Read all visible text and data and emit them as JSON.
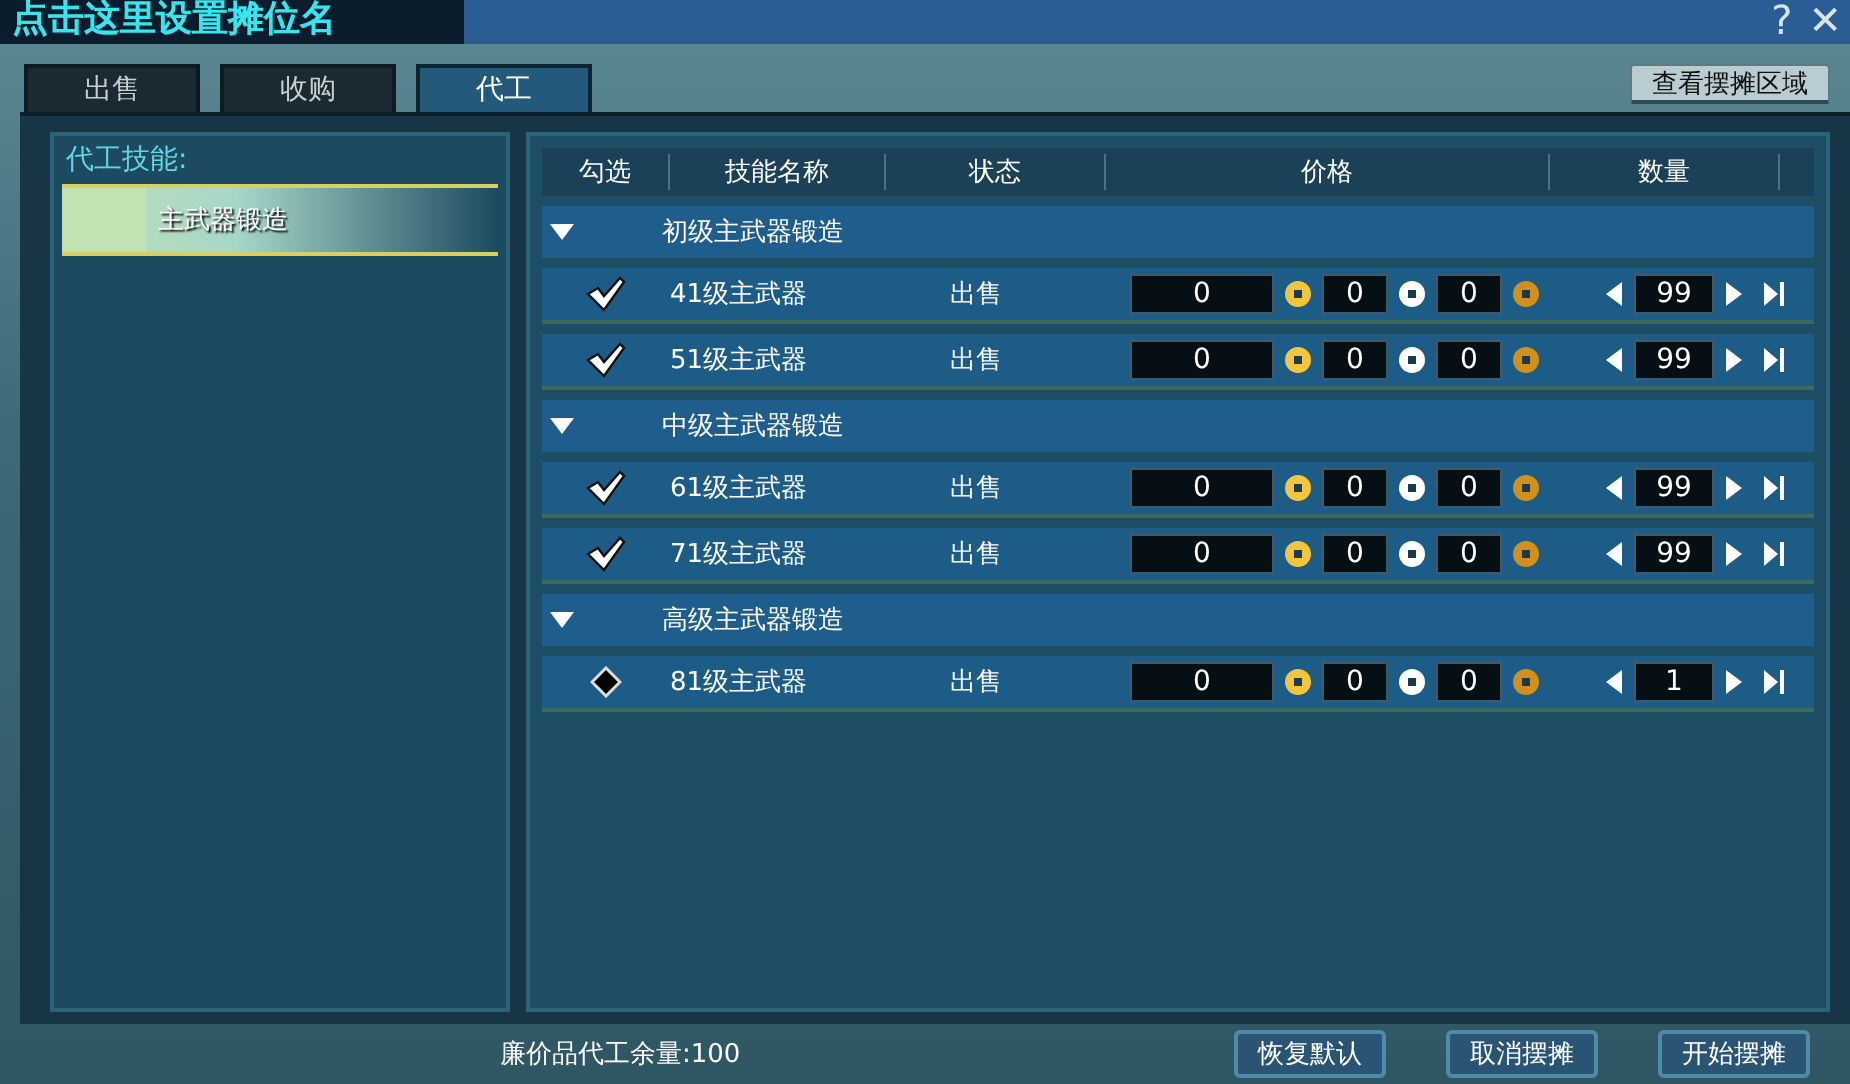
{
  "window": {
    "title": "点击这里设置摊位名",
    "help": "?",
    "close": "✕"
  },
  "tabs": [
    {
      "label": "出售",
      "selected": false
    },
    {
      "label": "收购",
      "selected": false
    },
    {
      "label": "代工",
      "selected": true
    }
  ],
  "view_area_button": "查看摆摊区域",
  "skills_panel": {
    "title": "代工技能:",
    "items": [
      {
        "label": "主武器锻造",
        "selected": true
      }
    ]
  },
  "table": {
    "columns": [
      "勾选",
      "技能名称",
      "状态",
      "价格",
      "数量"
    ],
    "groups": [
      {
        "name": "初级主武器锻造",
        "expanded": true,
        "rows": [
          {
            "checked": true,
            "name": "41级主武器",
            "status": "出售",
            "gold": "0",
            "silver": "0",
            "copper": "0",
            "quantity": "99"
          },
          {
            "checked": true,
            "name": "51级主武器",
            "status": "出售",
            "gold": "0",
            "silver": "0",
            "copper": "0",
            "quantity": "99"
          }
        ]
      },
      {
        "name": "中级主武器锻造",
        "expanded": true,
        "rows": [
          {
            "checked": true,
            "name": "61级主武器",
            "status": "出售",
            "gold": "0",
            "silver": "0",
            "copper": "0",
            "quantity": "99"
          },
          {
            "checked": true,
            "name": "71级主武器",
            "status": "出售",
            "gold": "0",
            "silver": "0",
            "copper": "0",
            "quantity": "99"
          }
        ]
      },
      {
        "name": "高级主武器锻造",
        "expanded": true,
        "rows": [
          {
            "checked": false,
            "name": "81级主武器",
            "status": "出售",
            "gold": "0",
            "silver": "0",
            "copper": "0",
            "quantity": "1"
          }
        ]
      }
    ]
  },
  "footer": {
    "remaining": "廉价品代工余量:100",
    "buttons": [
      "恢复默认",
      "取消摆摊",
      "开始摆摊"
    ]
  }
}
